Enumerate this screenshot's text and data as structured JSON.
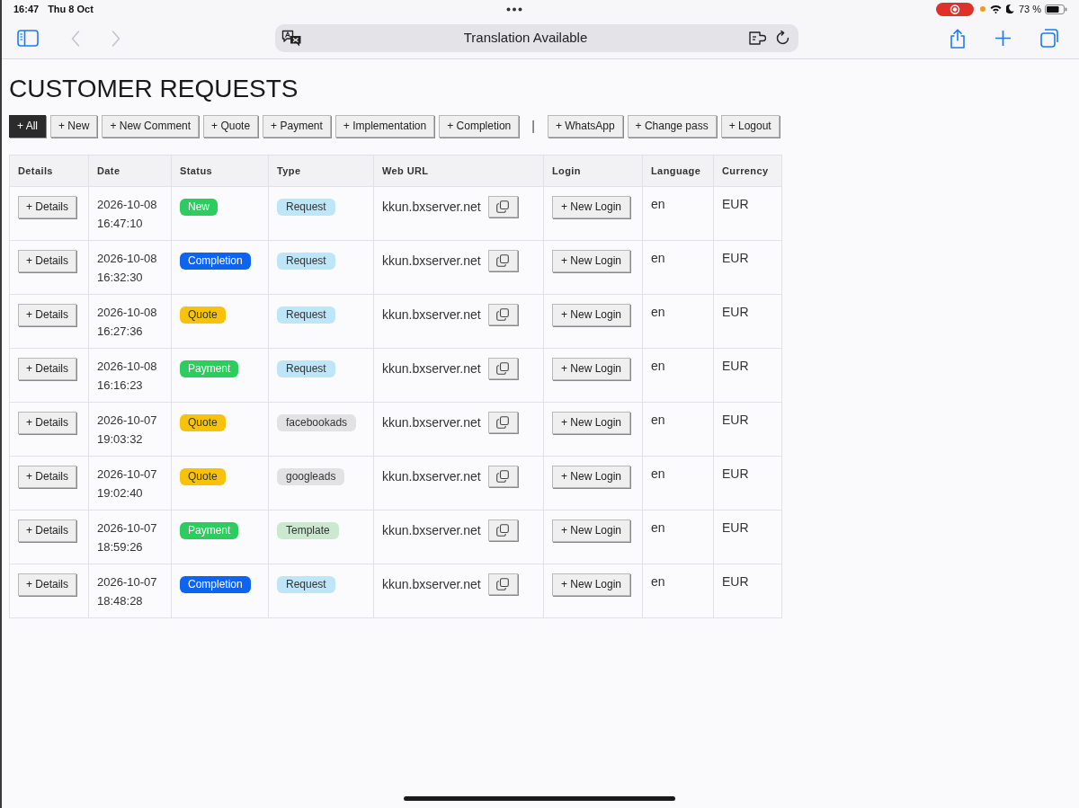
{
  "status_bar": {
    "time": "16:47",
    "date": "Thu 8 Oct",
    "battery_percent": "73 %"
  },
  "browser_toolbar": {
    "address_text": "Translation Available"
  },
  "page": {
    "title": "CUSTOMER REQUESTS"
  },
  "filter_buttons": [
    {
      "label": "+ All",
      "selected": true
    },
    {
      "label": "+ New",
      "selected": false
    },
    {
      "label": "+ New Comment",
      "selected": false
    },
    {
      "label": "+ Quote",
      "selected": false
    },
    {
      "label": "+ Payment",
      "selected": false
    },
    {
      "label": "+ Implementation",
      "selected": false
    },
    {
      "label": "+ Completion",
      "selected": false
    }
  ],
  "separator": "|",
  "action_buttons": [
    "+ WhatsApp",
    "+ Change pass",
    "+ Logout"
  ],
  "table": {
    "columns": [
      "Details",
      "Date",
      "Status",
      "Type",
      "Web URL",
      "Login",
      "Language",
      "Currency"
    ],
    "rows": [
      {
        "details_button": "+ Details",
        "date": "2026-10-08 16:47:10",
        "status": {
          "label": "New",
          "color": "#2ecc5e"
        },
        "type": {
          "label": "Request",
          "color": "#bee6f8"
        },
        "web_url": "kkun.bxserver.net",
        "login_button": "+ New Login",
        "language": "en",
        "currency": "EUR"
      },
      {
        "details_button": "+ Details",
        "date": "2026-10-08 16:32:30",
        "status": {
          "label": "Completion",
          "color": "#0d64ee"
        },
        "type": {
          "label": "Request",
          "color": "#bee6f8"
        },
        "web_url": "kkun.bxserver.net",
        "login_button": "+ New Login",
        "language": "en",
        "currency": "EUR"
      },
      {
        "details_button": "+ Details",
        "date": "2026-10-08 16:27:36",
        "status": {
          "label": "Quote",
          "color": "#f8c20b"
        },
        "type": {
          "label": "Request",
          "color": "#bee6f8"
        },
        "web_url": "kkun.bxserver.net",
        "login_button": "+ New Login",
        "language": "en",
        "currency": "EUR"
      },
      {
        "details_button": "+ Details",
        "date": "2026-10-08 16:16:23",
        "status": {
          "label": "Payment",
          "color": "#2ecc5e"
        },
        "type": {
          "label": "Request",
          "color": "#bee6f8"
        },
        "web_url": "kkun.bxserver.net",
        "login_button": "+ New Login",
        "language": "en",
        "currency": "EUR"
      },
      {
        "details_button": "+ Details",
        "date": "2026-10-07 19:03:32",
        "status": {
          "label": "Quote",
          "color": "#f8c20b"
        },
        "type": {
          "label": "facebookads",
          "color": "#e2e1e4"
        },
        "web_url": "kkun.bxserver.net",
        "login_button": "+ New Login",
        "language": "en",
        "currency": "EUR"
      },
      {
        "details_button": "+ Details",
        "date": "2026-10-07 19:02:40",
        "status": {
          "label": "Quote",
          "color": "#f8c20b"
        },
        "type": {
          "label": "googleads",
          "color": "#e2e1e4"
        },
        "web_url": "kkun.bxserver.net",
        "login_button": "+ New Login",
        "language": "en",
        "currency": "EUR"
      },
      {
        "details_button": "+ Details",
        "date": "2026-10-07 18:59:26",
        "status": {
          "label": "Payment",
          "color": "#2ecc5e"
        },
        "type": {
          "label": "Template",
          "color": "#cbe9cf"
        },
        "web_url": "kkun.bxserver.net",
        "login_button": "+ New Login",
        "language": "en",
        "currency": "EUR"
      },
      {
        "details_button": "+ Details",
        "date": "2026-10-07 18:48:28",
        "status": {
          "label": "Completion",
          "color": "#0d64ee"
        },
        "type": {
          "label": "Request",
          "color": "#bee6f8"
        },
        "web_url": "kkun.bxserver.net",
        "login_button": "+ New Login",
        "language": "en",
        "currency": "EUR"
      }
    ]
  }
}
